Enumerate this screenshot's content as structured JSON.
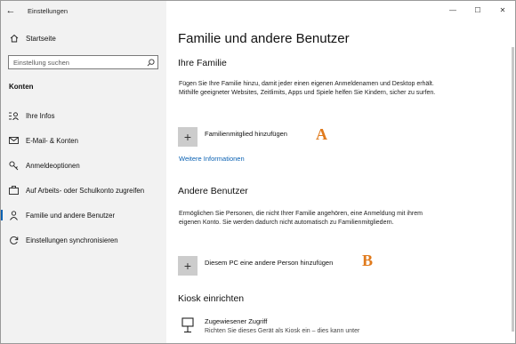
{
  "window": {
    "app_title": "Einstellungen"
  },
  "window_controls": {
    "minimize": "—",
    "maximize": "☐",
    "close": "✕"
  },
  "sidebar": {
    "home_label": "Startseite",
    "search_placeholder": "Einstellung suchen",
    "section_label": "Konten",
    "items": [
      {
        "label": "Ihre Infos",
        "icon": "person-info-icon"
      },
      {
        "label": "E-Mail- & Konten",
        "icon": "mail-icon"
      },
      {
        "label": "Anmeldeoptionen",
        "icon": "key-icon"
      },
      {
        "label": "Auf Arbeits- oder Schulkonto zugreifen",
        "icon": "briefcase-icon"
      },
      {
        "label": "Familie und andere Benutzer",
        "icon": "family-icon",
        "active": true
      },
      {
        "label": "Einstellungen synchronisieren",
        "icon": "sync-icon"
      }
    ]
  },
  "main": {
    "page_title": "Familie und andere Benutzer",
    "family": {
      "heading": "Ihre Familie",
      "description": "Fügen Sie Ihre Familie hinzu, damit jeder einen eigenen Anmeldenamen und Desktop erhält. Mithilfe geeigneter Websites, Zeitlimits, Apps und Spiele helfen Sie Kindern, sicher zu surfen.",
      "add_label": "Familienmitglied hinzufügen",
      "marker": "A",
      "more_link": "Weitere Informationen"
    },
    "others": {
      "heading": "Andere Benutzer",
      "description": "Ermöglichen Sie Personen, die nicht Ihrer Familie angehören, eine Anmeldung mit ihrem eigenen Konto. Sie werden dadurch nicht automatisch zu Familienmitgliedern.",
      "add_label": "Diesem PC eine andere Person hinzufügen",
      "marker": "B"
    },
    "kiosk": {
      "heading": "Kiosk einrichten",
      "item_title": "Zugewiesener Zugriff",
      "item_desc": "Richten Sie dieses Gerät als Kiosk ein – dies kann unter"
    },
    "plus_glyph": "+"
  },
  "colors": {
    "accent": "#0b62b3",
    "marker": "#e07a1c",
    "sidebar_bg": "#f2f2f2"
  }
}
